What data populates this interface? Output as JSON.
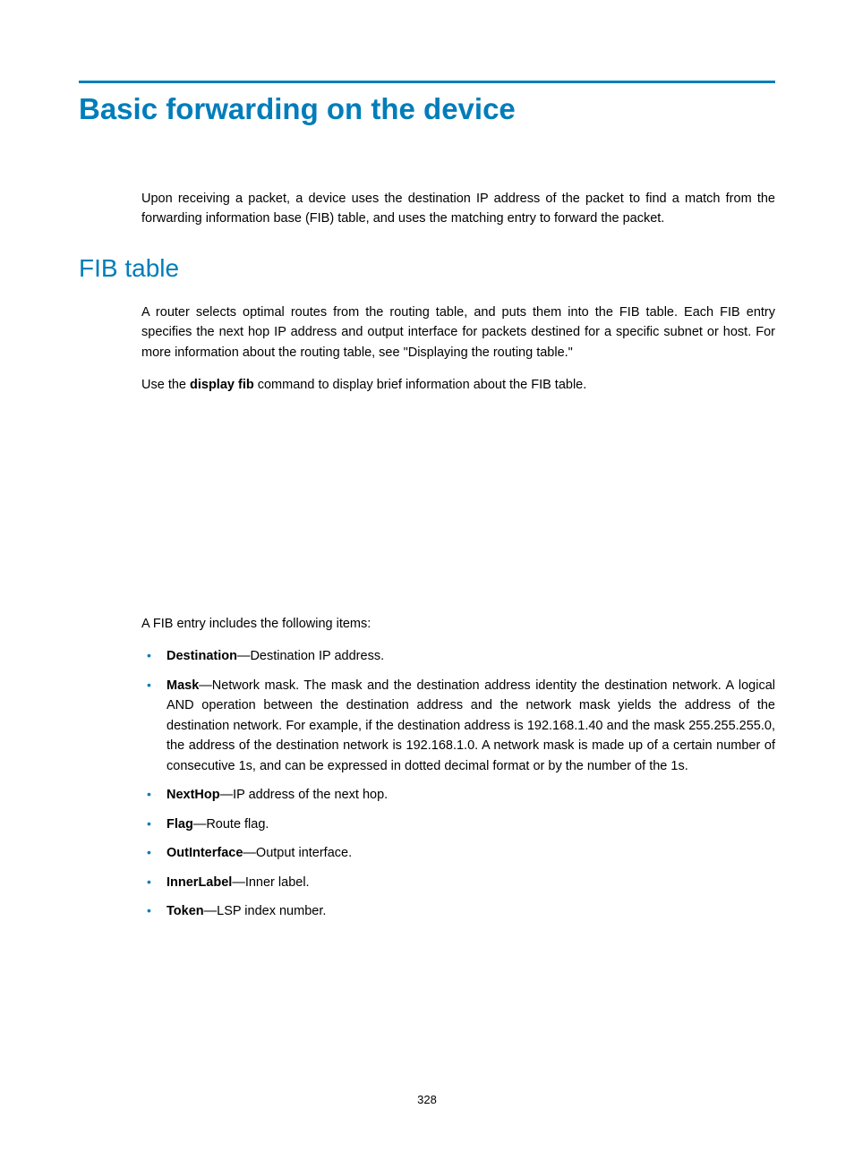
{
  "title": "Basic forwarding on the device",
  "intro": "Upon receiving a packet, a device uses the destination IP address of the packet to find a match from the forwarding information base (FIB) table, and uses the matching entry to forward the packet.",
  "section": {
    "heading": "FIB table",
    "para1": "A router selects optimal routes from the routing table, and puts them into the FIB table. Each FIB entry specifies the next hop IP address and output interface for packets destined for a specific subnet or host. For more information about the routing table, see \"Displaying the routing table.\"",
    "para2_pre": "Use the ",
    "para2_cmd": "display fib",
    "para2_post": " command to display brief information about the FIB table.",
    "para3": "A FIB entry includes the following items:",
    "items": [
      {
        "term": "Destination",
        "desc": "—Destination IP address."
      },
      {
        "term": "Mask",
        "desc": "—Network mask. The mask and the destination address identity the destination network. A logical AND operation between the destination address and the network mask yields the address of the destination network. For example, if the destination address is 192.168.1.40 and the mask 255.255.255.0, the address of the destination network is 192.168.1.0. A network mask is made up of a certain number of consecutive 1s, and can be expressed in dotted decimal format or by the number of the 1s."
      },
      {
        "term": "NextHop",
        "desc": "—IP address of the next hop."
      },
      {
        "term": "Flag",
        "desc": "—Route flag."
      },
      {
        "term": "OutInterface",
        "desc": "—Output interface."
      },
      {
        "term": "InnerLabel",
        "desc": "—Inner label."
      },
      {
        "term": "Token",
        "desc": "—LSP index number."
      }
    ]
  },
  "page_number": "328"
}
